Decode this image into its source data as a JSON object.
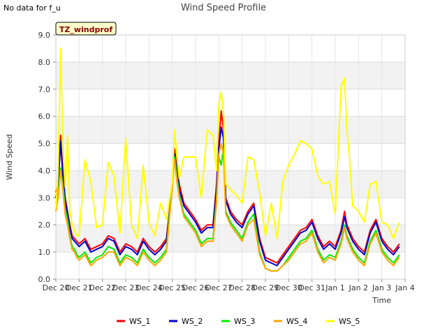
{
  "note": "No data for f_u",
  "chart_data": {
    "type": "line",
    "title": "Wind Speed Profile",
    "xlabel": "Time",
    "ylabel": "Wind Speed",
    "badge": "TZ_windprof",
    "ylim": [
      0,
      9
    ],
    "yticks": [
      "0.0",
      "1.0",
      "2.0",
      "3.0",
      "4.0",
      "5.0",
      "6.0",
      "7.0",
      "8.0",
      "9.0"
    ],
    "xlim": [
      0,
      15
    ],
    "xticks": [
      "Dec 20",
      "Dec 21",
      "Dec 22",
      "Dec 23",
      "Dec 24",
      "Dec 25",
      "Dec 26",
      "Dec 27",
      "Dec 28",
      "Dec 29",
      "Dec 30",
      "Dec 31",
      "Jan 1",
      "Jan 2",
      "Jan 3",
      "Jan 4"
    ],
    "grid": true,
    "legend_position": "bottom",
    "x": [
      0.0,
      0.1,
      0.2,
      0.3,
      0.4,
      0.5,
      0.6,
      0.7,
      0.8,
      0.9,
      1.0,
      1.25,
      1.5,
      1.75,
      2.0,
      2.25,
      2.5,
      2.75,
      3.0,
      3.25,
      3.5,
      3.75,
      4.0,
      4.25,
      4.5,
      4.75,
      5.0,
      5.1,
      5.2,
      5.3,
      5.5,
      5.75,
      6.0,
      6.25,
      6.5,
      6.75,
      6.9,
      7.0,
      7.1,
      7.2,
      7.3,
      7.5,
      7.75,
      8.0,
      8.25,
      8.5,
      8.75,
      9.0,
      9.25,
      9.5,
      9.75,
      10.0,
      10.25,
      10.5,
      10.75,
      11.0,
      11.25,
      11.5,
      11.75,
      12.0,
      12.25,
      12.4,
      12.5,
      12.6,
      12.75,
      13.0,
      13.25,
      13.5,
      13.75,
      14.0,
      14.25,
      14.5,
      14.75
    ],
    "series": [
      {
        "name": "WS_1",
        "color": "#ff0000",
        "values": [
          3.2,
          3.5,
          5.3,
          4.0,
          3.0,
          2.5,
          2.0,
          1.6,
          1.5,
          1.4,
          1.3,
          1.5,
          1.1,
          1.2,
          1.3,
          1.6,
          1.5,
          1.0,
          1.3,
          1.2,
          1.0,
          1.5,
          1.2,
          1.0,
          1.2,
          1.5,
          3.5,
          4.8,
          4.2,
          3.5,
          2.8,
          2.5,
          2.2,
          1.8,
          2.0,
          2.0,
          3.5,
          5.0,
          6.2,
          5.5,
          3.0,
          2.5,
          2.2,
          2.0,
          2.5,
          2.8,
          1.5,
          0.8,
          0.7,
          0.6,
          0.9,
          1.2,
          1.5,
          1.8,
          1.9,
          2.2,
          1.6,
          1.2,
          1.4,
          1.2,
          1.8,
          2.5,
          2.0,
          1.8,
          1.5,
          1.2,
          1.0,
          1.8,
          2.2,
          1.5,
          1.2,
          1.0,
          1.3
        ]
      },
      {
        "name": "WS_2",
        "color": "#0000cc",
        "values": [
          3.0,
          3.4,
          5.1,
          3.8,
          2.9,
          2.4,
          1.9,
          1.5,
          1.4,
          1.3,
          1.2,
          1.4,
          1.0,
          1.1,
          1.2,
          1.5,
          1.4,
          0.9,
          1.2,
          1.1,
          0.9,
          1.4,
          1.1,
          0.9,
          1.1,
          1.4,
          3.4,
          4.6,
          4.0,
          3.3,
          2.7,
          2.4,
          2.1,
          1.7,
          1.9,
          1.9,
          3.3,
          4.8,
          5.6,
          5.2,
          2.9,
          2.4,
          2.1,
          1.9,
          2.4,
          2.7,
          1.4,
          0.7,
          0.6,
          0.5,
          0.8,
          1.1,
          1.4,
          1.7,
          1.8,
          2.1,
          1.5,
          1.1,
          1.3,
          1.1,
          1.7,
          2.3,
          1.9,
          1.7,
          1.4,
          1.1,
          0.9,
          1.7,
          2.1,
          1.4,
          1.1,
          0.9,
          1.2
        ]
      },
      {
        "name": "WS_3",
        "color": "#00ee00",
        "values": [
          2.8,
          3.2,
          4.1,
          3.5,
          2.6,
          2.2,
          1.6,
          1.2,
          1.1,
          0.9,
          0.8,
          1.0,
          0.6,
          0.8,
          0.9,
          1.2,
          1.1,
          0.6,
          0.9,
          0.8,
          0.6,
          1.1,
          0.8,
          0.6,
          0.8,
          1.1,
          3.6,
          4.5,
          3.8,
          3.1,
          2.4,
          2.1,
          1.8,
          1.3,
          1.5,
          1.5,
          3.0,
          4.5,
          4.2,
          4.8,
          2.5,
          2.1,
          1.8,
          1.5,
          2.1,
          2.4,
          1.0,
          0.4,
          0.3,
          0.3,
          0.5,
          0.8,
          1.1,
          1.4,
          1.5,
          1.8,
          1.1,
          0.7,
          0.9,
          0.8,
          1.4,
          2.0,
          1.6,
          1.4,
          1.1,
          0.8,
          0.6,
          1.4,
          1.8,
          1.1,
          0.8,
          0.6,
          0.9
        ]
      },
      {
        "name": "WS_4",
        "color": "#ffa500",
        "values": [
          2.5,
          3.0,
          4.0,
          3.3,
          2.4,
          2.0,
          1.5,
          1.1,
          1.0,
          0.8,
          0.7,
          0.9,
          0.5,
          0.7,
          0.8,
          1.0,
          1.0,
          0.5,
          0.8,
          0.7,
          0.5,
          1.0,
          0.7,
          0.5,
          0.7,
          1.0,
          3.4,
          4.4,
          3.6,
          3.0,
          2.3,
          2.0,
          1.7,
          1.2,
          1.4,
          1.4,
          2.8,
          4.6,
          5.0,
          4.6,
          2.4,
          2.0,
          1.7,
          1.4,
          2.0,
          2.2,
          0.9,
          0.4,
          0.3,
          0.3,
          0.5,
          0.7,
          1.0,
          1.3,
          1.4,
          1.7,
          1.0,
          0.6,
          0.8,
          0.7,
          1.3,
          1.9,
          1.5,
          1.3,
          1.0,
          0.7,
          0.5,
          1.3,
          1.7,
          1.0,
          0.7,
          0.5,
          0.8
        ]
      },
      {
        "name": "WS_5",
        "color": "#ffff00",
        "values": [
          2.6,
          4.0,
          8.5,
          5.0,
          3.4,
          5.3,
          2.5,
          2.0,
          1.8,
          1.6,
          1.6,
          4.4,
          3.6,
          1.9,
          2.0,
          4.3,
          3.8,
          1.7,
          5.2,
          2.0,
          1.5,
          4.2,
          2.1,
          1.6,
          2.8,
          2.2,
          3.6,
          5.5,
          4.5,
          3.7,
          4.5,
          4.5,
          4.5,
          3.0,
          5.5,
          5.3,
          4.0,
          6.4,
          6.9,
          6.1,
          3.5,
          3.3,
          3.1,
          2.8,
          4.5,
          4.4,
          3.2,
          1.6,
          2.8,
          1.5,
          3.6,
          4.2,
          4.6,
          5.1,
          5.0,
          4.8,
          3.8,
          3.5,
          3.6,
          2.4,
          7.1,
          7.4,
          5.5,
          4.6,
          2.7,
          2.5,
          2.1,
          3.5,
          3.6,
          2.1,
          2.0,
          1.5,
          2.1
        ]
      }
    ]
  }
}
